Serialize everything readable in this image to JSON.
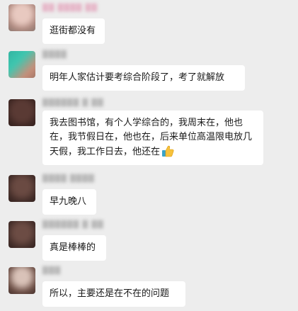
{
  "colors": {
    "background": "#ededed",
    "bubble": "#ffffff",
    "text": "#191919",
    "sender_name": "#b8b8b8",
    "emoji_yellow": "#f7c23b",
    "emoji_sleeve": "#3aa3c8"
  },
  "messages": [
    {
      "sender": "",
      "text": "逛街都没有",
      "avatar_icon": "avatar-blurred-icon"
    },
    {
      "sender": "",
      "text": "明年人家估计要考综合阶段了，考了就解放",
      "avatar_icon": "avatar-blurred-icon"
    },
    {
      "sender": "",
      "text": "我去图书馆，有个人学综合的，我周末在，他也在，我节假日在，他也在，后来单位高温限电放几天假，我工作日去，他还在",
      "emoji_icon": "thumbs-up-icon",
      "avatar_icon": "avatar-blurred-icon"
    },
    {
      "sender": "",
      "text": "早九晚八",
      "avatar_icon": "avatar-blurred-icon"
    },
    {
      "sender": "",
      "text": "真是棒棒的",
      "avatar_icon": "avatar-blurred-icon"
    },
    {
      "sender": "",
      "text": "所以，主要还是在不在的问题",
      "avatar_icon": "avatar-blurred-icon"
    }
  ]
}
